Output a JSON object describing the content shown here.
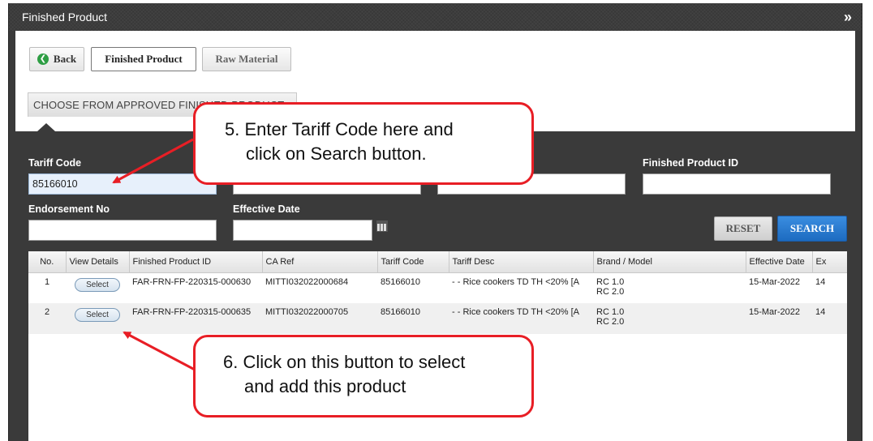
{
  "window": {
    "title": "Finished Product"
  },
  "toolbar": {
    "back_label": "Back",
    "finished_product_label": "Finished Product",
    "raw_material_label": "Raw Material"
  },
  "choose_button_label": "CHOOSE FROM APPROVED FINISHED PRODUCT",
  "search_form": {
    "tariff_code": {
      "label": "Tariff Code",
      "value": "85166010"
    },
    "finished_product_id": {
      "label": "Finished Product ID",
      "value": ""
    },
    "endorsement_no": {
      "label": "Endorsement No",
      "value": ""
    },
    "effective_date": {
      "label": "Effective Date",
      "value": ""
    },
    "reset_label": "RESET",
    "search_label": "SEARCH"
  },
  "table": {
    "columns": [
      "No.",
      "View Details",
      "Finished Product ID",
      "CA Ref",
      "Tariff Code",
      "Tariff Desc",
      "Brand / Model",
      "Effective Date",
      "Ex"
    ],
    "rows": [
      {
        "no": "1",
        "view": "Select",
        "fp_id": "FAR-FRN-FP-220315-000630",
        "ca_ref": "MITTI032022000684",
        "tariff_code": "85166010",
        "tariff_desc": "- - Rice cookers TD TH <20% [A",
        "brand_line1": "RC 1.0",
        "brand_line2": "RC 2.0",
        "effective_date": "15-Mar-2022",
        "ex": "14"
      },
      {
        "no": "2",
        "view": "Select",
        "fp_id": "FAR-FRN-FP-220315-000635",
        "ca_ref": "MITTI032022000705",
        "tariff_code": "85166010",
        "tariff_desc": "- - Rice cookers TD TH <20% [A",
        "brand_line1": "RC 1.0",
        "brand_line2": "RC 2.0",
        "effective_date": "15-Mar-2022",
        "ex": "14"
      }
    ]
  },
  "callouts": {
    "step5_line1": "5.  Enter Tariff Code here and",
    "step5_line2": "click on Search button.",
    "step6_line1": "6. Click on this button to select",
    "step6_line2": "and add this product"
  },
  "colors": {
    "annotation_red": "#e81e25",
    "search_blue": "#1d6bc0",
    "window_dark": "#3a3a3a"
  }
}
